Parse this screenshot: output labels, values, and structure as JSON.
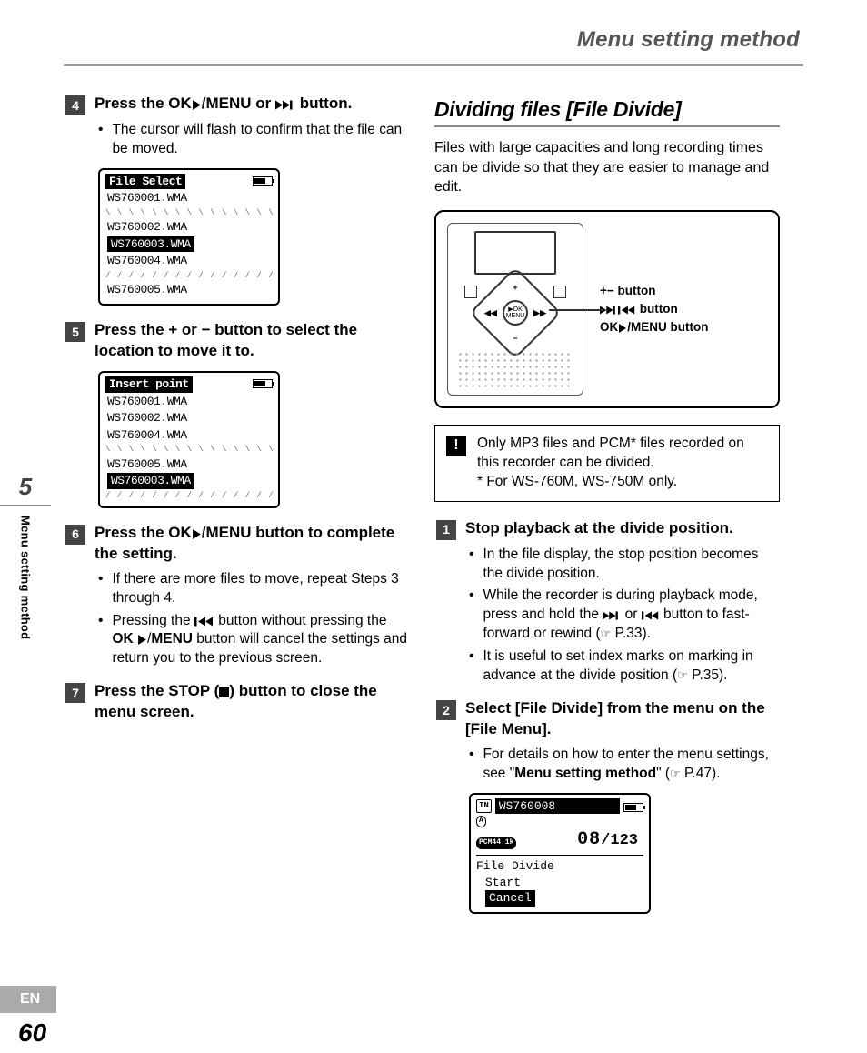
{
  "header": {
    "title": "Menu setting method"
  },
  "side": {
    "chapter": "5",
    "label": "Menu setting method",
    "lang": "EN",
    "page": "60"
  },
  "left": {
    "step4": {
      "num": "4",
      "title_a": "Press the ",
      "title_b": "OK",
      "title_c": "/MENU",
      "title_d": " or ",
      "title_e": " button.",
      "bullet1": "The cursor will flash to confirm that the file can be moved.",
      "lcd": {
        "title": "File Select",
        "rows": [
          "WS760001.WMA",
          "WS760002.WMA",
          "WS760003.WMA",
          "WS760004.WMA",
          "WS760005.WMA"
        ],
        "selectedIndex": 2
      }
    },
    "step5": {
      "num": "5",
      "title": "Press the + or − button to select the location to move it to.",
      "lcd": {
        "title": "Insert point",
        "rows": [
          "WS760001.WMA",
          "WS760002.WMA",
          "WS760004.WMA",
          "WS760005.WMA",
          "WS760003.WMA"
        ],
        "selectedIndex": 4
      }
    },
    "step6": {
      "num": "6",
      "title_a": "Press the ",
      "title_b": "OK",
      "title_c": "/MENU",
      "title_d": " button to complete the setting.",
      "bullet1": "If there are more files to move, repeat Steps 3 through 4.",
      "bullet2_a": "Pressing the ",
      "bullet2_b": " button without pressing the ",
      "bullet2_c": "OK ",
      "bullet2_d": "/",
      "bullet2_e": "MENU",
      "bullet2_f": " button will cancel the settings and return you to the previous screen."
    },
    "step7": {
      "num": "7",
      "title_a": "Press the ",
      "title_b": "STOP",
      "title_c": " (",
      "title_d": ") button to close the menu screen."
    }
  },
  "right": {
    "section_title": "Dividing files [File Divide]",
    "intro": "Files with large capacities and long recording times can be divide so that they are easier to manage and edit.",
    "labels": {
      "pm": "+− button",
      "ff": " button",
      "ok_a": "OK",
      "ok_b": "/MENU button"
    },
    "note": {
      "line1": "Only MP3 files and PCM* files recorded on this recorder can be divided.",
      "line2": "* For WS-760M, WS-750M only."
    },
    "step1": {
      "num": "1",
      "title": "Stop playback at the divide position.",
      "b1": "In the file display, the stop position becomes the divide position.",
      "b2_a": "While the recorder is during playback mode, press and hold the ",
      "b2_b": " or ",
      "b2_c": " button to fast-forward or rewind (",
      "b2_d": " P.33).",
      "b3_a": "It is useful to set index marks on marking in advance at the divide position (",
      "b3_b": " P.35)."
    },
    "step2": {
      "num": "2",
      "title_a": "Select [",
      "title_b": "File Divide",
      "title_c": "] from the menu on the [",
      "title_d": "File Menu",
      "title_e": "].",
      "b1_a": "For details on how to enter the menu settings, see \"",
      "b1_b": "Menu setting method",
      "b1_c": "\" (",
      "b1_d": " P.47).",
      "lcd": {
        "file": "WS760008",
        "folder": "A",
        "fmt": "PCM44.1k",
        "idx_current": "08",
        "idx_total": "123",
        "menu_title": "File Divide",
        "opt1": "Start",
        "opt2": "Cancel"
      }
    }
  }
}
